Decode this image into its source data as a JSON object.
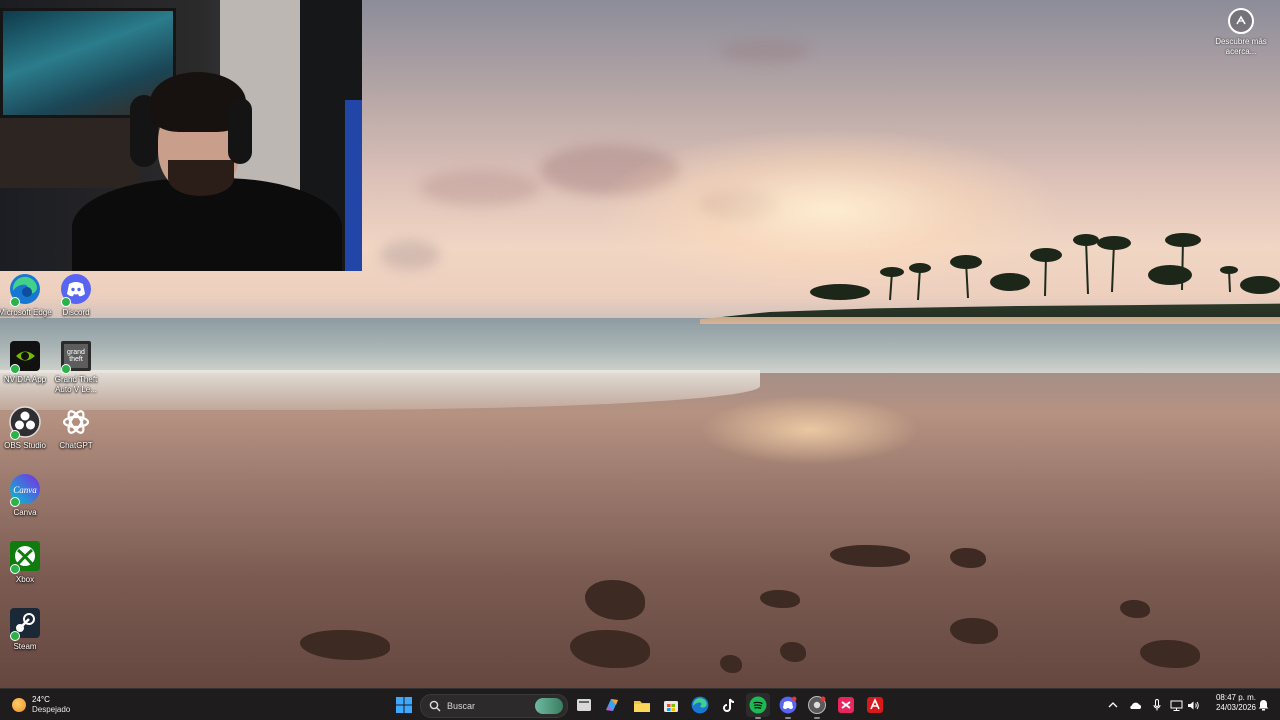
{
  "desktop_icons": [
    {
      "name": "microsoft-edge-desktop-icon",
      "label": "Microsoft Edge",
      "icon": "edge-icon"
    },
    {
      "name": "discord-desktop-icon",
      "label": "Discord",
      "icon": "discord-icon"
    },
    {
      "name": "nvidia-app-desktop-icon",
      "label": "NVIDIA App",
      "icon": "nvidia-icon"
    },
    {
      "name": "gta-v-desktop-icon",
      "label": "Grand Theft Auto V Le...",
      "icon": "gta-icon"
    },
    {
      "name": "obs-studio-desktop-icon",
      "label": "OBS Studio",
      "icon": "obs-icon"
    },
    {
      "name": "chatgpt-desktop-icon",
      "label": "ChatGPT",
      "icon": "chatgpt-icon"
    },
    {
      "name": "canva-desktop-icon",
      "label": "Canva",
      "icon": "canva-icon"
    },
    {
      "name": "xbox-desktop-icon",
      "label": "Xbox",
      "icon": "xbox-icon"
    },
    {
      "name": "steam-desktop-icon",
      "label": "Steam",
      "icon": "steam-icon"
    }
  ],
  "discover": {
    "label": "Descubre más acerca...",
    "icon": "camera-icon"
  },
  "taskbar": {
    "weather": {
      "temp": "24°C",
      "condition": "Despejado",
      "icon": "sun-icon"
    },
    "search": {
      "placeholder": "Buscar",
      "icon": "search-icon"
    },
    "pinned": [
      "start-icon",
      "task-view-icon",
      "copilot-icon",
      "file-explorer-icon",
      "store-icon",
      "edge-icon",
      "tiktok-icon",
      "spotify-icon",
      "discord-icon",
      "chrome-icon",
      "capcut-icon",
      "acrobat-icon"
    ],
    "tray": [
      "chevron-up-icon",
      "onedrive-icon",
      "microphone-icon",
      "network-icon",
      "volume-icon",
      "notification-icon"
    ],
    "time": "08:47 p. m.",
    "date": "24/03/2026"
  },
  "colors": {
    "taskbar": "#1f1c1d",
    "accent": "#0f6cbd",
    "spotify": "#1db954",
    "discord": "#5865f2"
  }
}
